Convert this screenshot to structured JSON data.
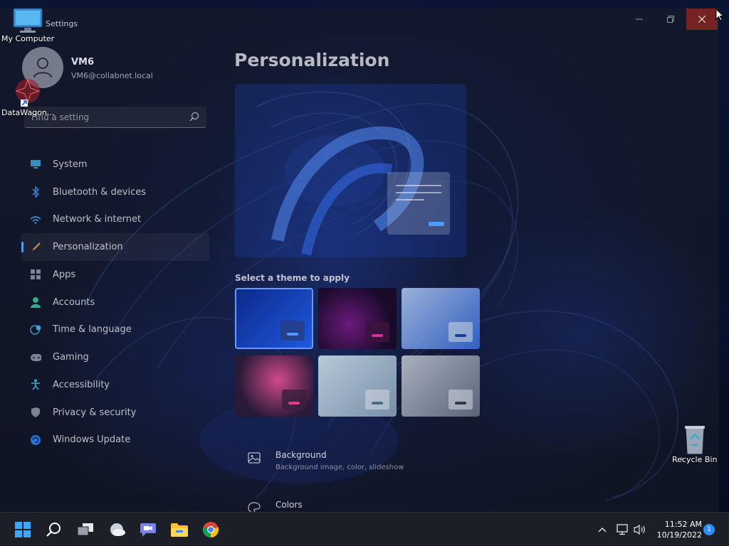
{
  "window": {
    "title": "Settings",
    "minimize_icon": "minimize-icon",
    "maximize_icon": "restore-icon",
    "close_icon": "close-icon"
  },
  "profile": {
    "name": "VM6",
    "email": "VM6@collabnet.local"
  },
  "search": {
    "placeholder": "Find a setting"
  },
  "nav": {
    "items": [
      {
        "label": "System",
        "icon": "monitor-icon",
        "color": "#4cc2ff"
      },
      {
        "label": "Bluetooth & devices",
        "icon": "bluetooth-icon",
        "color": "#4c9bff"
      },
      {
        "label": "Network & internet",
        "icon": "wifi-icon",
        "color": "#3ab0ff"
      },
      {
        "label": "Personalization",
        "icon": "brush-icon",
        "color": "#f0a060"
      },
      {
        "label": "Apps",
        "icon": "apps-icon",
        "color": "#9aa8c0"
      },
      {
        "label": "Accounts",
        "icon": "person-icon",
        "color": "#3fd0a0"
      },
      {
        "label": "Time & language",
        "icon": "globe-clock-icon",
        "color": "#4cc2ff"
      },
      {
        "label": "Gaming",
        "icon": "gamepad-icon",
        "color": "#a0a8b8"
      },
      {
        "label": "Accessibility",
        "icon": "accessibility-icon",
        "color": "#4cc2ff"
      },
      {
        "label": "Privacy & security",
        "icon": "shield-icon",
        "color": "#a0a8b8"
      },
      {
        "label": "Windows Update",
        "icon": "update-icon",
        "color": "#2c8fff"
      }
    ],
    "active_index": 3
  },
  "main": {
    "title": "Personalization",
    "theme_heading": "Select a theme to apply",
    "rows": [
      {
        "label": "Background",
        "sub": "Background image, color, slideshow",
        "icon": "image-icon"
      },
      {
        "label": "Colors",
        "sub": "",
        "icon": "palette-icon"
      }
    ]
  },
  "desktop": {
    "icons": [
      {
        "label": "My Computer",
        "icon": "computer-icon"
      },
      {
        "label": "DataWagon...",
        "icon": "datawagon-icon"
      },
      {
        "label": "Recycle Bin",
        "icon": "recycle-bin-icon"
      }
    ]
  },
  "taskbar": {
    "time": "11:52 AM",
    "date": "10/19/2022",
    "notification_count": "1",
    "apps": [
      "start-icon",
      "search-icon",
      "task-view-icon",
      "weather-icon",
      "teams-chat-icon",
      "file-explorer-icon",
      "chrome-icon"
    ],
    "tray": [
      "chevron-up-icon",
      "network-icon",
      "volume-icon"
    ]
  }
}
